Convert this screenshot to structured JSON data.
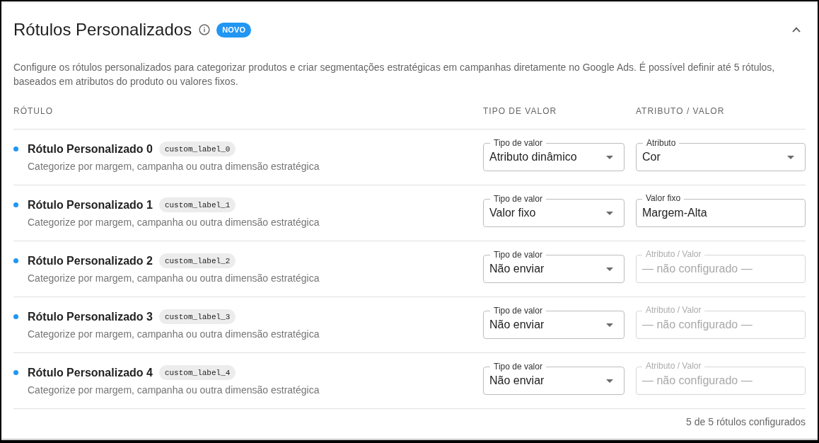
{
  "panel": {
    "title": "Rótulos Personalizados",
    "badge": "NOVO",
    "expanded": true,
    "description": "Configure os rótulos personalizados para categorizar produtos e criar segmentações estratégicas em campanhas diretamente no Google Ads. É possível definir até 5 rótulos, baseados em atributos do produto ou valores fixos.",
    "columns": [
      "RÓTULO",
      "TIPO DE VALOR",
      "ATRIBUTO / VALOR"
    ],
    "rows": [
      {
        "name": "Rótulo Personalizado 0",
        "code": "custom_label_0",
        "hint": "Categorize por margem, campanha ou outra dimensão estratégica",
        "type_field": {
          "label": "Tipo de valor",
          "value": "Atributo dinâmico"
        },
        "value_field": {
          "kind": "select",
          "label": "Atributo",
          "value": "Cor",
          "disabled": false
        }
      },
      {
        "name": "Rótulo Personalizado 1",
        "code": "custom_label_1",
        "hint": "Categorize por margem, campanha ou outra dimensão estratégica",
        "type_field": {
          "label": "Tipo de valor",
          "value": "Valor fixo"
        },
        "value_field": {
          "kind": "input",
          "label": "Valor fixo",
          "value": "Margem-Alta",
          "disabled": false
        }
      },
      {
        "name": "Rótulo Personalizado 2",
        "code": "custom_label_2",
        "hint": "Categorize por margem, campanha ou outra dimensão estratégica",
        "type_field": {
          "label": "Tipo de valor",
          "value": "Não enviar"
        },
        "value_field": {
          "kind": "input",
          "label": "Atributo / Valor",
          "placeholder": "— não configurado —",
          "disabled": true
        }
      },
      {
        "name": "Rótulo Personalizado 3",
        "code": "custom_label_3",
        "hint": "Categorize por margem, campanha ou outra dimensão estratégica",
        "type_field": {
          "label": "Tipo de valor",
          "value": "Não enviar"
        },
        "value_field": {
          "kind": "input",
          "label": "Atributo / Valor",
          "placeholder": "— não configurado —",
          "disabled": true
        }
      },
      {
        "name": "Rótulo Personalizado 4",
        "code": "custom_label_4",
        "hint": "Categorize por margem, campanha ou outra dimensão estratégica",
        "type_field": {
          "label": "Tipo de valor",
          "value": "Não enviar"
        },
        "value_field": {
          "kind": "input",
          "label": "Atributo / Valor",
          "placeholder": "— não configurado —",
          "disabled": true
        }
      }
    ],
    "footer": "5 de 5 rótulos configurados"
  }
}
